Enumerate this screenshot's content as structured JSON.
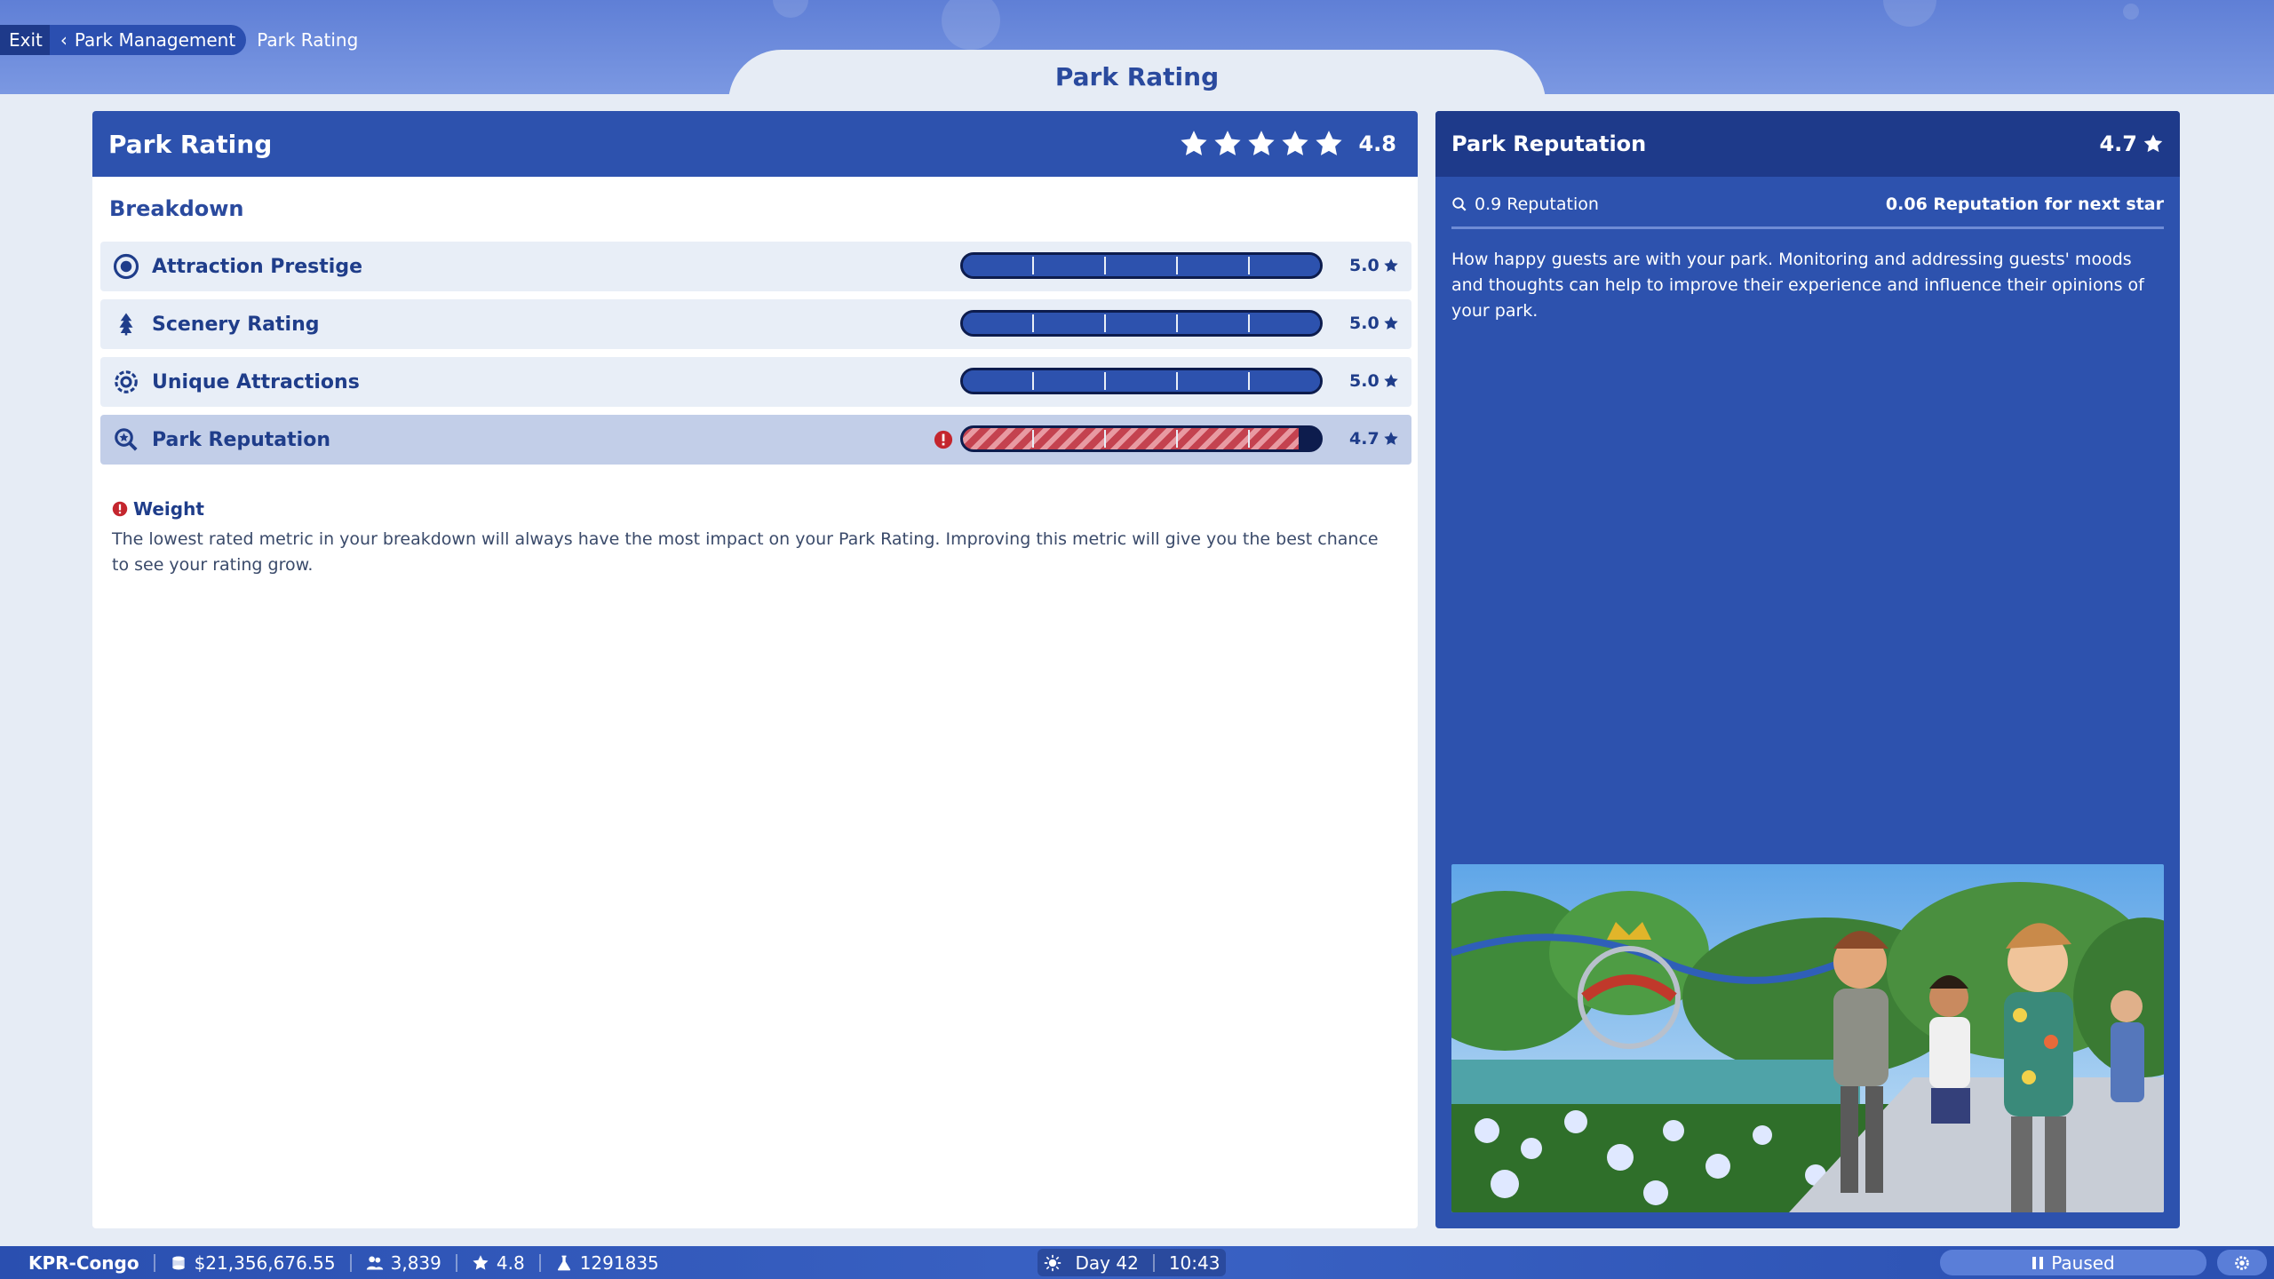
{
  "breadcrumb": {
    "exit_label": "Exit",
    "parent_label": "Park Management",
    "current_label": "Park Rating"
  },
  "page_title": "Park Rating",
  "left_panel": {
    "title": "Park Rating",
    "stars_filled": 5,
    "rating": "4.8",
    "section_title": "Breakdown",
    "metrics": [
      {
        "label": "Attraction Prestige",
        "value": "5.0",
        "fraction": 1.0,
        "icon": "prestige-icon",
        "warning": false
      },
      {
        "label": "Scenery Rating",
        "value": "5.0",
        "fraction": 1.0,
        "icon": "tree-icon",
        "warning": false
      },
      {
        "label": "Unique Attractions",
        "value": "5.0",
        "fraction": 1.0,
        "icon": "gear-badge-icon",
        "warning": false
      },
      {
        "label": "Park Reputation",
        "value": "4.7",
        "fraction": 0.94,
        "icon": "reputation-icon",
        "warning": true
      }
    ],
    "weight_title": "Weight",
    "weight_text": "The lowest rated metric in your breakdown will always have the most impact on your Park Rating. Improving this metric will give you the best chance to see your rating grow."
  },
  "right_panel": {
    "title": "Park Reputation",
    "rating": "4.7",
    "reputation_value": "0.9 Reputation",
    "next_star": "0.06 Reputation for next star",
    "description": "How happy guests are with your park. Monitoring and addressing guests' moods and thoughts can help to improve their experience and influence their opinions of your park."
  },
  "bottom_bar": {
    "park_name": "KPR-Congo",
    "money": "$21,356,676.55",
    "guests": "3,839",
    "rating": "4.8",
    "research": "1291835",
    "day": "Day 42",
    "time": "10:43",
    "status": "Paused"
  },
  "colors": {
    "accent_blue": "#2d52ae",
    "dark_blue": "#1e3a8a",
    "warning_red": "#c4424f"
  }
}
